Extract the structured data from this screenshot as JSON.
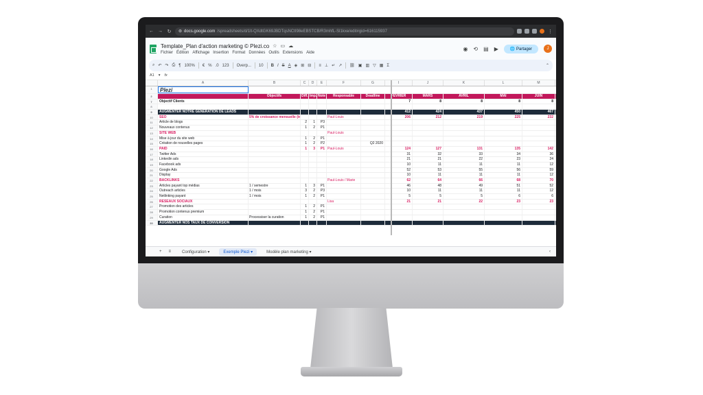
{
  "browser": {
    "url_host": "docs.google.com",
    "url_path": "/spreadsheets/d/1lt-QXdtGK69JBDTqsNCtI98eEBSTCB/R3mhfL-Sl1kxe/edit#gid=616115937"
  },
  "sheets": {
    "title": "Template_Plan d'action marketing © Plezi.co",
    "menus": [
      "Fichier",
      "Édition",
      "Affichage",
      "Insertion",
      "Format",
      "Données",
      "Outils",
      "Extensions",
      "Aide"
    ],
    "share_label": "Partager",
    "avatar_letter": "J",
    "zoom": "100%",
    "font": "Overp...",
    "font_size": "10",
    "cell_ref": "A1",
    "fx": "fx"
  },
  "grid": {
    "col_letters": [
      "A",
      "B",
      "C",
      "D",
      "E",
      "F",
      "G",
      "I",
      "J",
      "K",
      "L",
      "M"
    ],
    "logo_text": "Plezi",
    "headers": [
      "Objectifs",
      "Diff.",
      "Imp.",
      "Note",
      "Responsable",
      "Deadline",
      "FÉVRIER",
      "MARS",
      "AVRIL",
      "MAI",
      "JUIN"
    ],
    "rows": [
      {
        "n": "7",
        "type": "bold",
        "cells": [
          "Objectif Clients",
          "",
          "",
          "",
          "",
          "",
          "",
          "7",
          "8",
          "8",
          "8",
          "8"
        ]
      },
      {
        "n": "8",
        "type": "blank",
        "cells": [
          "",
          "",
          "",
          "",
          "",
          "",
          "",
          "",
          "",
          "",
          "",
          ""
        ]
      },
      {
        "n": "9",
        "type": "section",
        "cells": [
          "AUGMENTER NOTRE GENERATION DE LEADS",
          "",
          "",
          "",
          "",
          "",
          "",
          "412",
          "424",
          "437",
          "450",
          "467"
        ]
      },
      {
        "n": "10",
        "type": "sub",
        "cells": [
          "SEO",
          "5% de croissance mensuelle (trafic)",
          "",
          "",
          "",
          "Paul-Louis",
          "",
          "206",
          "212",
          "219",
          "225",
          "232"
        ]
      },
      {
        "n": "11",
        "type": "normal",
        "cells": [
          "Article de blogs",
          "",
          "2",
          "1",
          "P3",
          "",
          "",
          "",
          "",
          "",
          "",
          ""
        ]
      },
      {
        "n": "12",
        "type": "normal",
        "cells": [
          "Nouveaux contenus",
          "",
          "1",
          "2",
          "P1",
          "",
          "",
          "",
          "",
          "",
          "",
          ""
        ]
      },
      {
        "n": "13",
        "type": "sub",
        "cells": [
          "SITE WEB",
          "",
          "",
          "",
          "",
          "Paul-Louis",
          "",
          "",
          "",
          "",
          "",
          ""
        ]
      },
      {
        "n": "14",
        "type": "normal",
        "cells": [
          "Mise à jour du site web",
          "",
          "1",
          "2",
          "P1",
          "",
          "",
          "",
          "",
          "",
          "",
          ""
        ]
      },
      {
        "n": "15",
        "type": "normal",
        "cells": [
          "Création de nouvelles pages",
          "",
          "1",
          "2",
          "P2",
          "",
          "Q2 2020",
          "",
          "",
          "",
          "",
          ""
        ]
      },
      {
        "n": "16",
        "type": "sub",
        "cells": [
          "PAID",
          "",
          "1",
          "3",
          "P1",
          "Paul-Louis",
          "",
          "124",
          "127",
          "131",
          "135",
          "142"
        ]
      },
      {
        "n": "17",
        "type": "normal",
        "cells": [
          "Twitter Ads",
          "",
          "",
          "",
          "",
          "",
          "",
          "31",
          "32",
          "33",
          "34",
          "36"
        ]
      },
      {
        "n": "18",
        "type": "normal",
        "cells": [
          "Linkedin ads",
          "",
          "",
          "",
          "",
          "",
          "",
          "21",
          "21",
          "22",
          "23",
          "24"
        ]
      },
      {
        "n": "19",
        "type": "normal",
        "cells": [
          "Facebook ads",
          "",
          "",
          "",
          "",
          "",
          "",
          "10",
          "11",
          "11",
          "11",
          "12"
        ]
      },
      {
        "n": "20",
        "type": "normal",
        "cells": [
          "Google Ads",
          "",
          "",
          "",
          "",
          "",
          "",
          "52",
          "53",
          "55",
          "56",
          "59"
        ]
      },
      {
        "n": "21",
        "type": "normal",
        "cells": [
          "Display",
          "",
          "",
          "",
          "",
          "",
          "",
          "10",
          "11",
          "11",
          "11",
          "12"
        ]
      },
      {
        "n": "22",
        "type": "sub",
        "cells": [
          "BACKLINKS",
          "",
          "",
          "",
          "",
          "Paul-Louis / Marie",
          "",
          "62",
          "64",
          "66",
          "68",
          "70"
        ]
      },
      {
        "n": "23",
        "type": "normal",
        "cells": [
          "Articles payant top médias",
          "1 / semestre",
          "1",
          "3",
          "P1",
          "",
          "",
          "46",
          "48",
          "49",
          "51",
          "52"
        ]
      },
      {
        "n": "24",
        "type": "normal",
        "cells": [
          "Outreach articles",
          "1 / mois",
          "3",
          "2",
          "P3",
          "",
          "",
          "10",
          "11",
          "11",
          "11",
          "12"
        ]
      },
      {
        "n": "25",
        "type": "normal",
        "cells": [
          "Netlinking payant",
          "1 / mois",
          "1",
          "2",
          "P1",
          "",
          "",
          "5",
          "5",
          "5",
          "6",
          "6"
        ]
      },
      {
        "n": "26",
        "type": "sub",
        "cells": [
          "RESEAUX SOCIAUX",
          "",
          "",
          "",
          "",
          "Lisa",
          "",
          "21",
          "21",
          "22",
          "23",
          "23"
        ]
      },
      {
        "n": "27",
        "type": "normal",
        "cells": [
          "Promotion des articles",
          "",
          "1",
          "2",
          "P1",
          "",
          "",
          "",
          "",
          "",
          "",
          ""
        ]
      },
      {
        "n": "28",
        "type": "normal",
        "cells": [
          "Promotion contenus premium",
          "",
          "1",
          "2",
          "P1",
          "",
          "",
          "",
          "",
          "",
          "",
          ""
        ]
      },
      {
        "n": "29",
        "type": "normal",
        "cells": [
          "Curation",
          "Processiser la curation",
          "1",
          "2",
          "P1",
          "",
          "",
          "",
          "",
          "",
          "",
          ""
        ]
      },
      {
        "n": "30",
        "type": "section",
        "cells": [
          "AUGMENTER NOS TAUX DE CONVERSION",
          "",
          "",
          "",
          "",
          "",
          "",
          "",
          "",
          "",
          "",
          ""
        ]
      }
    ]
  },
  "tabs": [
    "Configuration",
    "Exemple Plezi",
    "Modèle plan marketing"
  ],
  "active_tab": 1
}
